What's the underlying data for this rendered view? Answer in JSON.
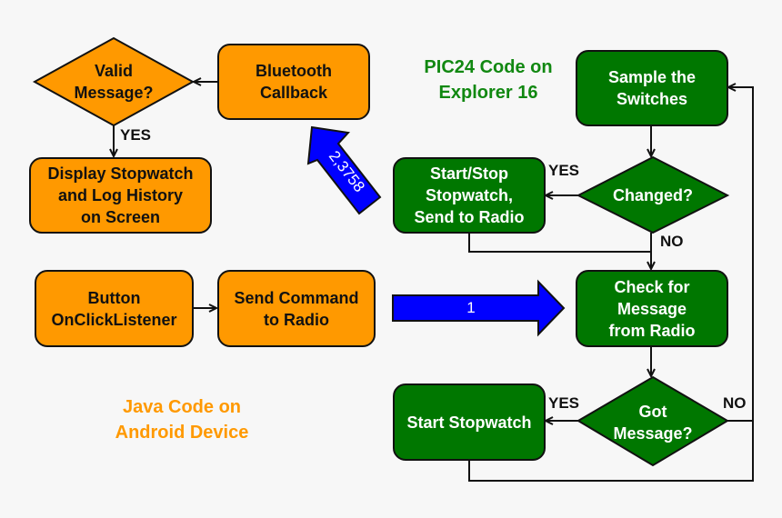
{
  "colors": {
    "android": "#ff9900",
    "pic": "#007700",
    "message_arrow": "#0000ff",
    "background": "#f7f7f7"
  },
  "android": {
    "title": "Java Code on\nAndroid Device",
    "valid_message": "Valid\nMessage?",
    "bluetooth_callback": "Bluetooth\nCallback",
    "display": "Display Stopwatch\nand Log History\non Screen",
    "button_listener": "Button\nOnClickListener",
    "send_command": "Send Command\nto Radio",
    "yes_label": "YES"
  },
  "pic": {
    "title": "PIC24 Code on\nExplorer 16",
    "sample": "Sample the\nSwitches",
    "changed": "Changed?",
    "start_stop": "Start/Stop\nStopwatch,\nSend to Radio",
    "check_message": "Check for\nMessage\nfrom Radio",
    "got_message": "Got\nMessage?",
    "start_stopwatch": "Start Stopwatch",
    "changed_yes": "YES",
    "changed_no": "NO",
    "got_yes": "YES",
    "got_no": "NO"
  },
  "messages": {
    "to_pic_label": "1",
    "to_android_label": "2,3758"
  }
}
